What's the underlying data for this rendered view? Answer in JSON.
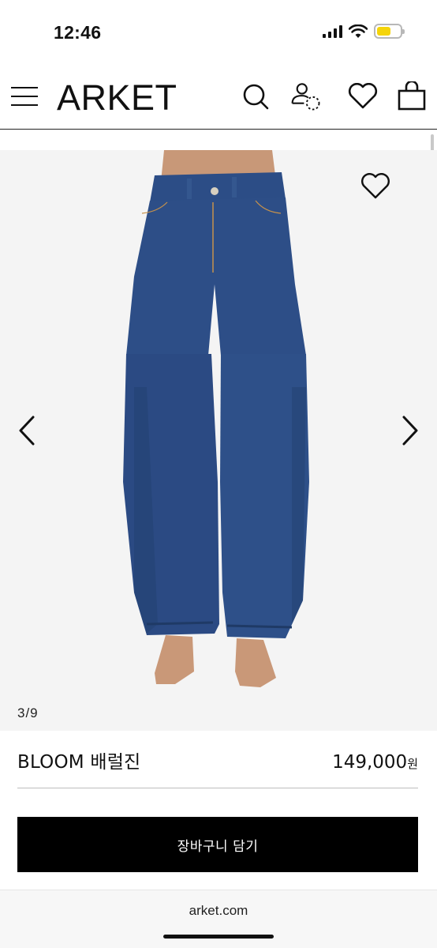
{
  "status_bar": {
    "time": "12:46",
    "signal_icon": "cellular-signal-icon",
    "wifi_icon": "wifi-icon",
    "battery_icon": "battery-icon",
    "battery_color": "#f5d40a"
  },
  "nav": {
    "menu_icon": "hamburger-menu-icon",
    "logo": "ARKET",
    "search_icon": "search-icon",
    "account_icon": "account-icon",
    "wishlist_icon": "heart-icon",
    "bag_icon": "shopping-bag-icon"
  },
  "gallery": {
    "favorite_icon": "heart-outline-icon",
    "prev_icon": "chevron-left-icon",
    "next_icon": "chevron-right-icon",
    "counter": "3/9",
    "image_subject": "barrel-jeans-photo"
  },
  "product": {
    "name": "BLOOM 배럴진",
    "price": "149,000",
    "currency": "원"
  },
  "cart": {
    "button_label": "장바구니 담기",
    "button_color": "#000000"
  },
  "browser": {
    "url": "arket.com"
  }
}
